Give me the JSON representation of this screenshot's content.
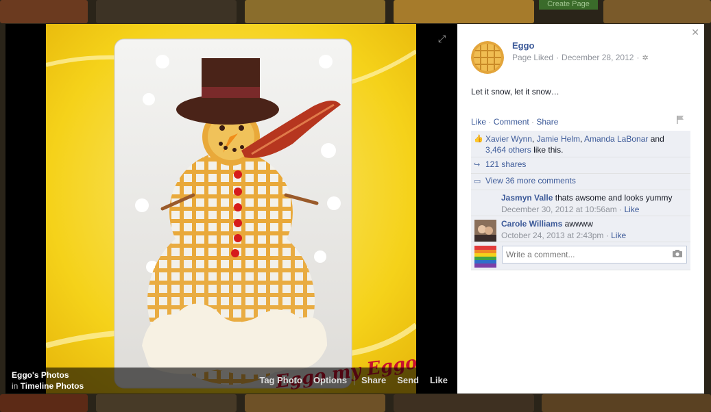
{
  "background": {
    "create_page_label": "Create Page"
  },
  "photo": {
    "watermark": "Eggo my Eggo",
    "album": "Eggo's Photos",
    "in_word": "in",
    "album_parent": "Timeline Photos",
    "actions": [
      "Tag Photo",
      "Options",
      "Share",
      "Send",
      "Like"
    ]
  },
  "panel": {
    "page_name": "Eggo",
    "page_status": "Page Liked",
    "date": "December 28, 2012",
    "caption": "Let it snow, let it snow…",
    "ufi": [
      "Like",
      "Comment",
      "Share"
    ],
    "likers": [
      "Xavier Wynn",
      "Jamie Helm",
      "Amanda LaBonar"
    ],
    "likes_and": "and",
    "others_count": "3,464 others",
    "likes_suffix": "like this.",
    "shares": "121 shares",
    "more_comments": "View 36 more comments",
    "comments": [
      {
        "author": "Jasmyn Valle",
        "text": "thats awsome and looks yummy",
        "time": "December 30, 2012 at 10:56am",
        "like": "Like"
      },
      {
        "author": "Carole Williams",
        "text": "awwww",
        "time": "October 24, 2013 at 2:43pm",
        "like": "Like"
      }
    ],
    "comment_placeholder": "Write a comment..."
  },
  "colors": {
    "link_blue": "#3b5998",
    "photo_yellow": "#f5d21a"
  }
}
